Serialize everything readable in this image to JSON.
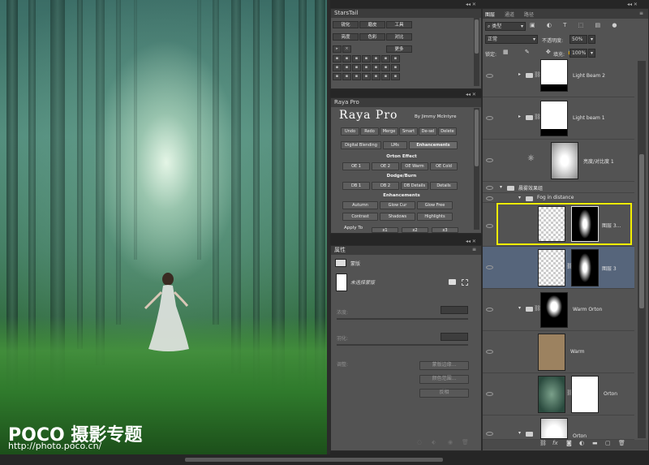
{
  "photo": {
    "watermark_brand": "POCO 摄影专题",
    "watermark_url": "http://photo.poco.cn/"
  },
  "stars_tail": {
    "title": "StarsTail",
    "row1": [
      "锐化",
      "磨皮",
      "工具"
    ],
    "row2": [
      "亮度",
      "色彩",
      "对比"
    ],
    "more": "更多"
  },
  "raya": {
    "title": "Raya Pro",
    "heading": "Raya Pro",
    "byline": "By Jimmy McIntyre",
    "top_buttons": [
      "Undo",
      "Redo",
      "Merge",
      "Smart",
      "De-sel",
      "Delete"
    ],
    "tabs": [
      "Digital Blending",
      "LMs",
      "Enhancements"
    ],
    "orton_title": "Orton Effect",
    "orton_buttons": [
      "OE 1",
      "OE 2",
      "OE Warm",
      "OE Cold"
    ],
    "dodge_title": "Dodge/Burn",
    "dodge_buttons": [
      "DB 1",
      "DB 2",
      "DB Details",
      "Details"
    ],
    "enh_title": "Enhancements",
    "enh_row1": [
      "Autumn",
      "Glow Cur",
      "Glow Free"
    ],
    "enh_row2": [
      "Contrast",
      "Shadows",
      "Highlights"
    ],
    "apply_to": "Apply To",
    "apply_buttons": [
      "x1",
      "x2",
      "x3"
    ]
  },
  "properties": {
    "title": "属性",
    "mask_label": "蒙版",
    "mask_status": "未选择蒙版",
    "density_label": "浓度:",
    "feather_label": "羽化:",
    "adjust_label": "调整:",
    "btn_mask_edge": "蒙版边缘...",
    "btn_color_range": "颜色范围...",
    "btn_invert": "反相"
  },
  "layers": {
    "tabs": [
      "图层",
      "通道",
      "路径"
    ],
    "filter_label": "类型",
    "blend_mode": "正常",
    "opacity_label": "不透明度:",
    "opacity_value": "50%",
    "lock_label": "锁定:",
    "fill_label": "填充:",
    "fill_value": "100%",
    "rows": [
      {
        "name": "Light Beam 2"
      },
      {
        "name": "Light beam 1"
      },
      {
        "name": "亮度/对比度 1"
      },
      {
        "name": "晨雾效果组"
      },
      {
        "name": "Fog in distance"
      },
      {
        "name": "图层 3..."
      },
      {
        "name": "图层 3"
      },
      {
        "name": "Warm Orton"
      },
      {
        "name": "Warm"
      },
      {
        "name": "Orton"
      },
      {
        "name": "Orton"
      }
    ],
    "footer_icons": [
      "link-icon",
      "fx-icon",
      "mask-icon",
      "adjustment-icon",
      "folder-icon",
      "new-layer-icon",
      "trash-icon"
    ]
  },
  "colors": {
    "selected_row": "#56657b",
    "highlight_box": "#f2ee00",
    "panel_bg": "#535353"
  }
}
